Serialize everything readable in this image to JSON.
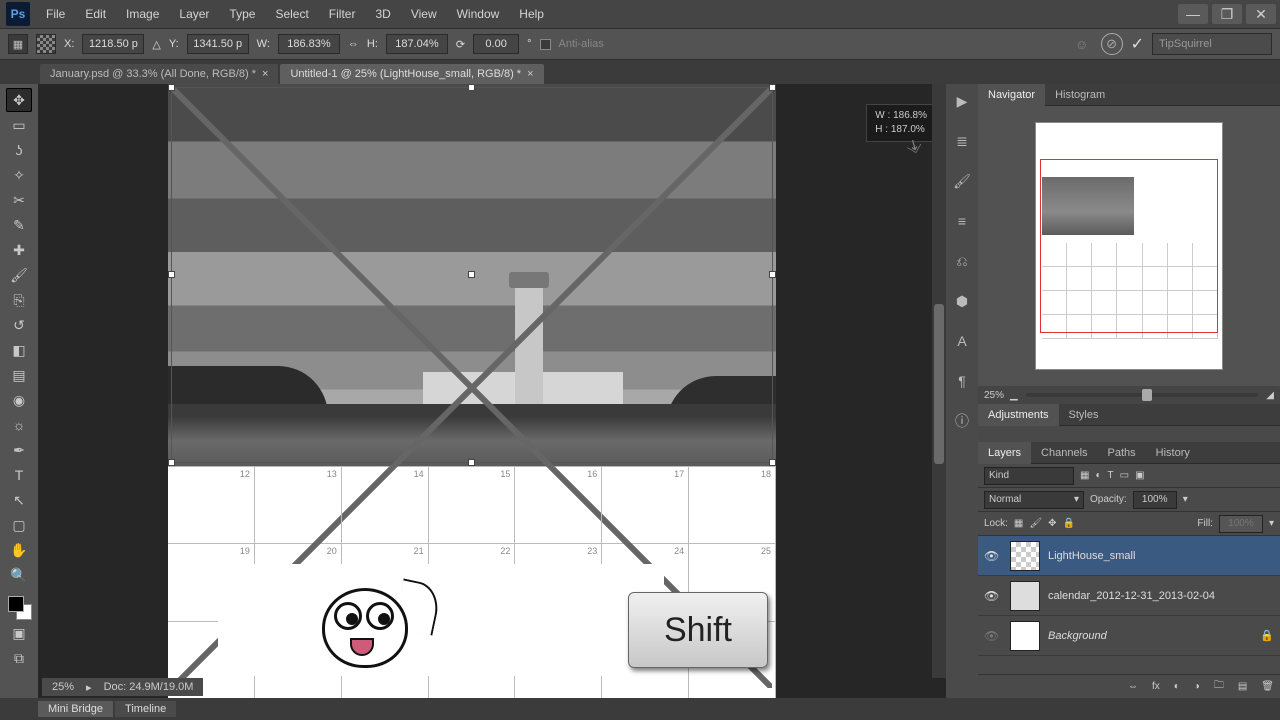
{
  "app": {
    "logo": "Ps"
  },
  "menu": [
    "File",
    "Edit",
    "Image",
    "Layer",
    "Type",
    "Select",
    "Filter",
    "3D",
    "View",
    "Window",
    "Help"
  ],
  "window_controls": [
    "minimize",
    "restore",
    "close"
  ],
  "options": {
    "x_label": "X:",
    "x": "1218.50 p",
    "y_label": "Y:",
    "y": "1341.50 p",
    "w_label": "W:",
    "w": "186.83%",
    "h_label": "H:",
    "h": "187.04%",
    "rot_label": "",
    "rot": "0.00",
    "antialias_label": "Anti-alias",
    "help_search": "TipSquirrel"
  },
  "tabs": [
    {
      "title": "January.psd @ 33.3% (All Done, RGB/8) *",
      "active": false
    },
    {
      "title": "Untitled-1 @ 25% (LightHouse_small, RGB/8) *",
      "active": true
    }
  ],
  "tools": [
    "move",
    "marquee",
    "lasso",
    "magic-wand",
    "crop",
    "eyedropper",
    "healing",
    "brush",
    "clone",
    "history-brush",
    "eraser",
    "gradient",
    "blur",
    "dodge",
    "pen",
    "type",
    "path-select",
    "rectangle",
    "hand",
    "zoom"
  ],
  "transform_info": {
    "w_label": "W :",
    "w_val": "186.8%",
    "h_label": "H :",
    "h_val": "187.0%"
  },
  "canvas": {
    "zoom_status": "25%",
    "doc_status": "Doc: 24.9M/19.0M"
  },
  "bottom_tabs": [
    "Mini Bridge",
    "Timeline"
  ],
  "navigator": {
    "tabs": [
      "Navigator",
      "Histogram"
    ],
    "zoom": "25%"
  },
  "adjustments": {
    "tabs": [
      "Adjustments",
      "Styles"
    ]
  },
  "layers_panel": {
    "tabs": [
      "Layers",
      "Channels",
      "Paths",
      "History"
    ],
    "kind_label": "Kind",
    "blend": "Normal",
    "opacity_label": "Opacity:",
    "opacity": "100%",
    "lock_label": "Lock:",
    "fill_label": "Fill:",
    "fill": "100%",
    "layers": [
      {
        "name": "LightHouse_small",
        "visible": true,
        "selected": true,
        "italic": false
      },
      {
        "name": "calendar_2012-12-31_2013-02-04",
        "visible": true,
        "selected": false,
        "italic": false
      },
      {
        "name": "Background",
        "visible": true,
        "selected": false,
        "italic": true
      }
    ]
  },
  "overlay": {
    "key": "Shift"
  },
  "calendar_cells_row1": [
    "12",
    "13",
    "14",
    "15",
    "16",
    "17",
    "18"
  ],
  "calendar_cells_row2": [
    "19",
    "20",
    "21",
    "22",
    "23",
    "24",
    "25"
  ]
}
